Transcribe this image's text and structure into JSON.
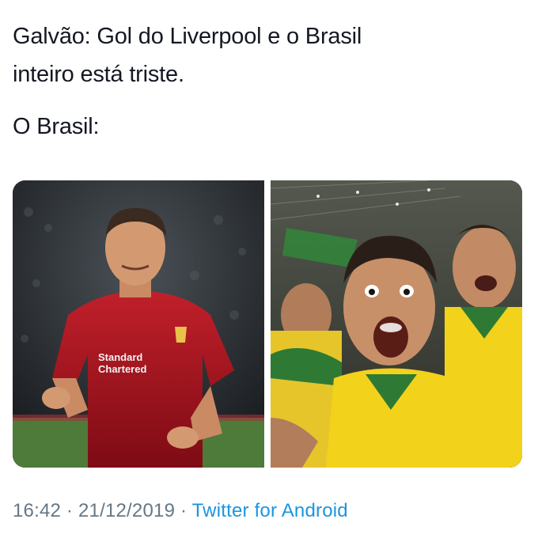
{
  "tweet": {
    "line1": "Galvão: Gol do Liverpool e o Brasil",
    "line2": "inteiro está triste.",
    "line3": "O Brasil:"
  },
  "media": {
    "left_photo_desc_icon": "celebrating-footballer-image",
    "right_photo_desc_icon": "shocked-fans-image",
    "jersey_sponsor_line1": "Standard",
    "jersey_sponsor_line2": "Chartered"
  },
  "meta": {
    "time": "16:42",
    "sep1": " · ",
    "date": "21/12/2019",
    "sep2": " · ",
    "source": "Twitter for Android"
  },
  "colors": {
    "text": "#141823",
    "meta": "#657786",
    "link": "#1b95e0",
    "liverpool_red": "#b0141e",
    "brazil_yellow": "#f2d21a"
  }
}
